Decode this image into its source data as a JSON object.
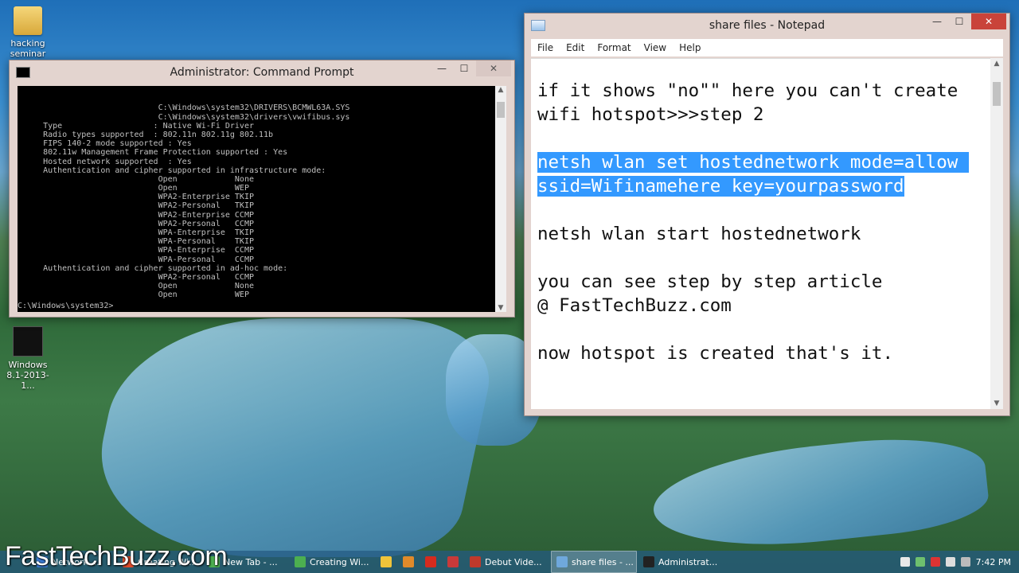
{
  "desktop": {
    "icons": [
      {
        "label": "hacking seminar"
      },
      {
        "label": "Windows 8.1-2013-1..."
      }
    ]
  },
  "cmd": {
    "title": "Administrator: Command Prompt",
    "lines": [
      "                            C:\\Windows\\system32\\DRIVERS\\BCMWL63A.SYS",
      "                            C:\\Windows\\system32\\drivers\\vwifibus.sys",
      "    Type                   : Native Wi-Fi Driver",
      "    Radio types supported  : 802.11n 802.11g 802.11b",
      "    FIPS 140-2 mode supported : Yes",
      "    802.11w Management Frame Protection supported : Yes",
      "    Hosted network supported  : Yes",
      "    Authentication and cipher supported in infrastructure mode:",
      "                            Open            None",
      "                            Open            WEP",
      "                            WPA2-Enterprise TKIP",
      "                            WPA2-Personal   TKIP",
      "                            WPA2-Enterprise CCMP",
      "                            WPA2-Personal   CCMP",
      "                            WPA-Enterprise  TKIP",
      "                            WPA-Personal    TKIP",
      "                            WPA-Enterprise  CCMP",
      "                            WPA-Personal    CCMP",
      "    Authentication and cipher supported in ad-hoc mode:",
      "                            WPA2-Personal   CCMP",
      "                            Open            None",
      "                            Open            WEP"
    ],
    "prompt": "C:\\Windows\\system32>"
  },
  "notepad": {
    "title": "share files - Notepad",
    "menu": [
      "File",
      "Edit",
      "Format",
      "View",
      "Help"
    ],
    "lines": [
      {
        "text": "if it shows \"no\"\" here you can't create",
        "selected": false
      },
      {
        "text": "wifi hotspot>>>step 2",
        "selected": false
      },
      {
        "text": "",
        "selected": false
      },
      {
        "text": "netsh wlan set hostednetwork mode=allow ",
        "selected": true
      },
      {
        "text": "ssid=Wifinamehere key=yourpassword",
        "selected": true
      },
      {
        "text": "",
        "selected": false
      },
      {
        "text": "netsh wlan start hostednetwork",
        "selected": false
      },
      {
        "text": "",
        "selected": false
      },
      {
        "text": "you can see step by step article",
        "selected": false
      },
      {
        "text": "@ FastTechBuzz.com",
        "selected": false
      },
      {
        "text": "",
        "selected": false
      },
      {
        "text": "now hotspot is created that's it.",
        "selected": false
      }
    ]
  },
  "watermark": "FastTechBuzz.com",
  "taskbar": {
    "items": [
      {
        "label": "Network ...",
        "color": "#3b7bd6",
        "active": false
      },
      {
        "label": "Creating Wi...",
        "color": "#e04a2a",
        "active": false
      },
      {
        "label": "New Tab - ...",
        "color": "#4caf50",
        "active": false
      },
      {
        "label": "Creating Wi...",
        "color": "#4caf50",
        "active": false
      },
      {
        "label": "",
        "color": "#f0c43a",
        "active": false
      },
      {
        "label": "",
        "color": "#e08a2a",
        "active": false
      },
      {
        "label": "",
        "color": "#d52b1e",
        "active": false
      },
      {
        "label": "",
        "color": "#c83a3a",
        "active": false
      },
      {
        "label": "Debut Vide...",
        "color": "#c0392b",
        "active": false
      },
      {
        "label": "share files - ...",
        "color": "#6fa8dc",
        "active": true
      },
      {
        "label": "Administrat...",
        "color": "#222222",
        "active": false
      }
    ],
    "time": "7:42 PM"
  }
}
